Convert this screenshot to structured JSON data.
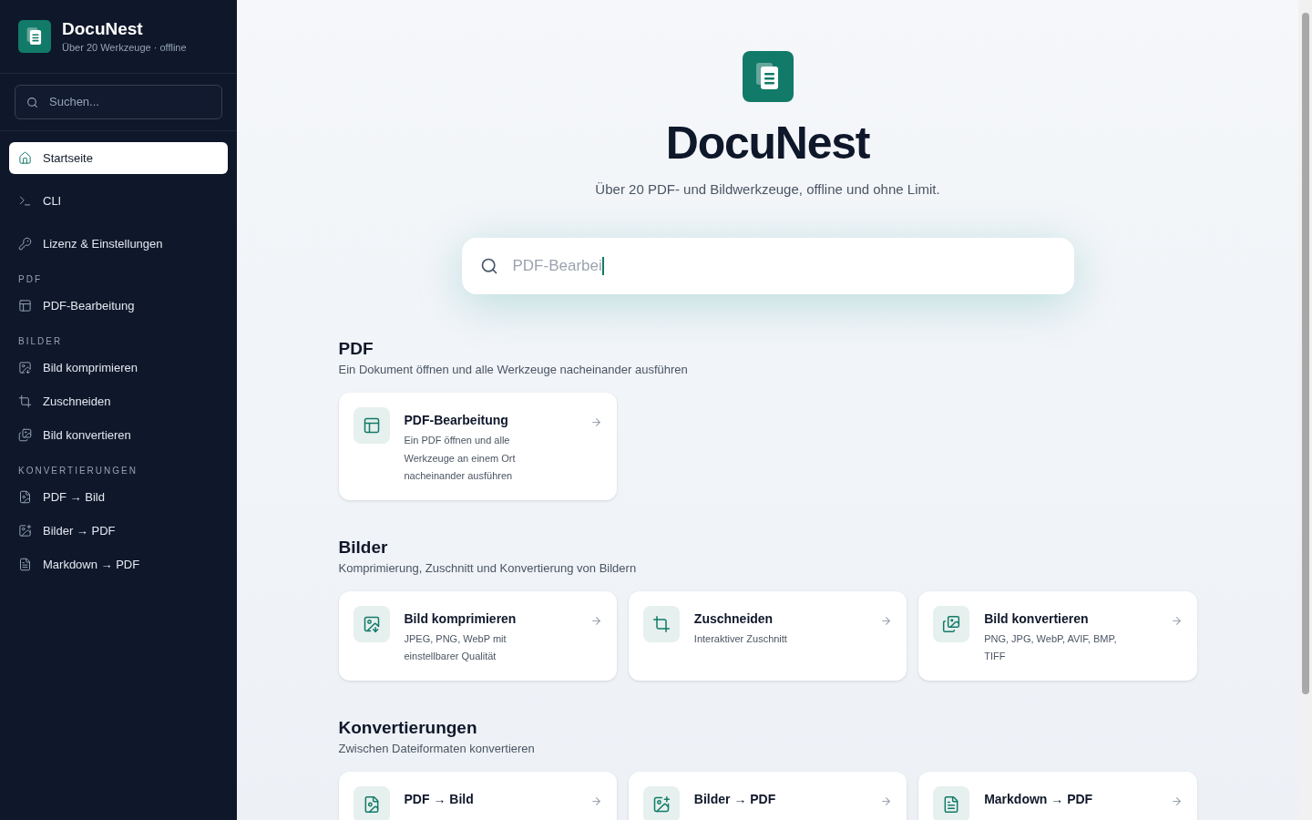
{
  "sidebar": {
    "brand": {
      "name": "DocuNest",
      "tagline": "Über 20 Werkzeuge · offline"
    },
    "search": {
      "placeholder": "Suchen..."
    },
    "nav": [
      {
        "label": "Startseite",
        "selected": true
      },
      {
        "label": "CLI",
        "selected": false
      },
      {
        "label": "Lizenz & Einstellungen",
        "selected": false
      }
    ],
    "sections": [
      {
        "heading": "PDF",
        "items": [
          {
            "label": "PDF-Bearbeitung",
            "selected": false
          }
        ]
      },
      {
        "heading": "BILDER",
        "items": [
          {
            "label": "Bild komprimieren",
            "selected": false
          },
          {
            "label": "Zuschneiden",
            "selected": false
          },
          {
            "label": "Bild konvertieren",
            "selected": false
          }
        ]
      },
      {
        "heading": "KONVERTIERUNGEN",
        "items": [
          {
            "label": "PDF → Bild",
            "selected": false
          },
          {
            "label": "Bilder → PDF",
            "selected": false
          },
          {
            "label": "Markdown → PDF",
            "selected": false
          }
        ]
      }
    ]
  },
  "hero": {
    "title": "DocuNest",
    "subtitle": "Über 20 PDF- und Bildwerkzeuge, offline und ohne Limit.",
    "search": {
      "placeholder": "PDF-Bearbei"
    }
  },
  "groups": [
    {
      "title": "PDF",
      "subtitle": "Ein Dokument öffnen und alle Werkzeuge nacheinander ausführen",
      "tools": [
        {
          "name": "PDF-Bearbeitung",
          "description": "Ein PDF öffnen und alle Werkzeuge an einem Ort nacheinander ausführen"
        }
      ]
    },
    {
      "title": "Bilder",
      "subtitle": "Komprimierung, Zuschnitt und Konvertierung von Bildern",
      "tools": [
        {
          "name": "Bild komprimieren",
          "description": "JPEG, PNG, WebP mit einstellbarer Qualität"
        },
        {
          "name": "Zuschneiden",
          "description": "Interaktiver Zuschnitt"
        },
        {
          "name": "Bild konvertieren",
          "description": "PNG, JPG, WebP, AVIF, BMP, TIFF"
        }
      ]
    },
    {
      "title": "Konvertierungen",
      "subtitle": "Zwischen Dateiformaten konvertieren",
      "tools": [
        {
          "name": "PDF → Bild"
        },
        {
          "name": "Bilder → PDF"
        },
        {
          "name": "Markdown → PDF"
        }
      ]
    }
  ]
}
